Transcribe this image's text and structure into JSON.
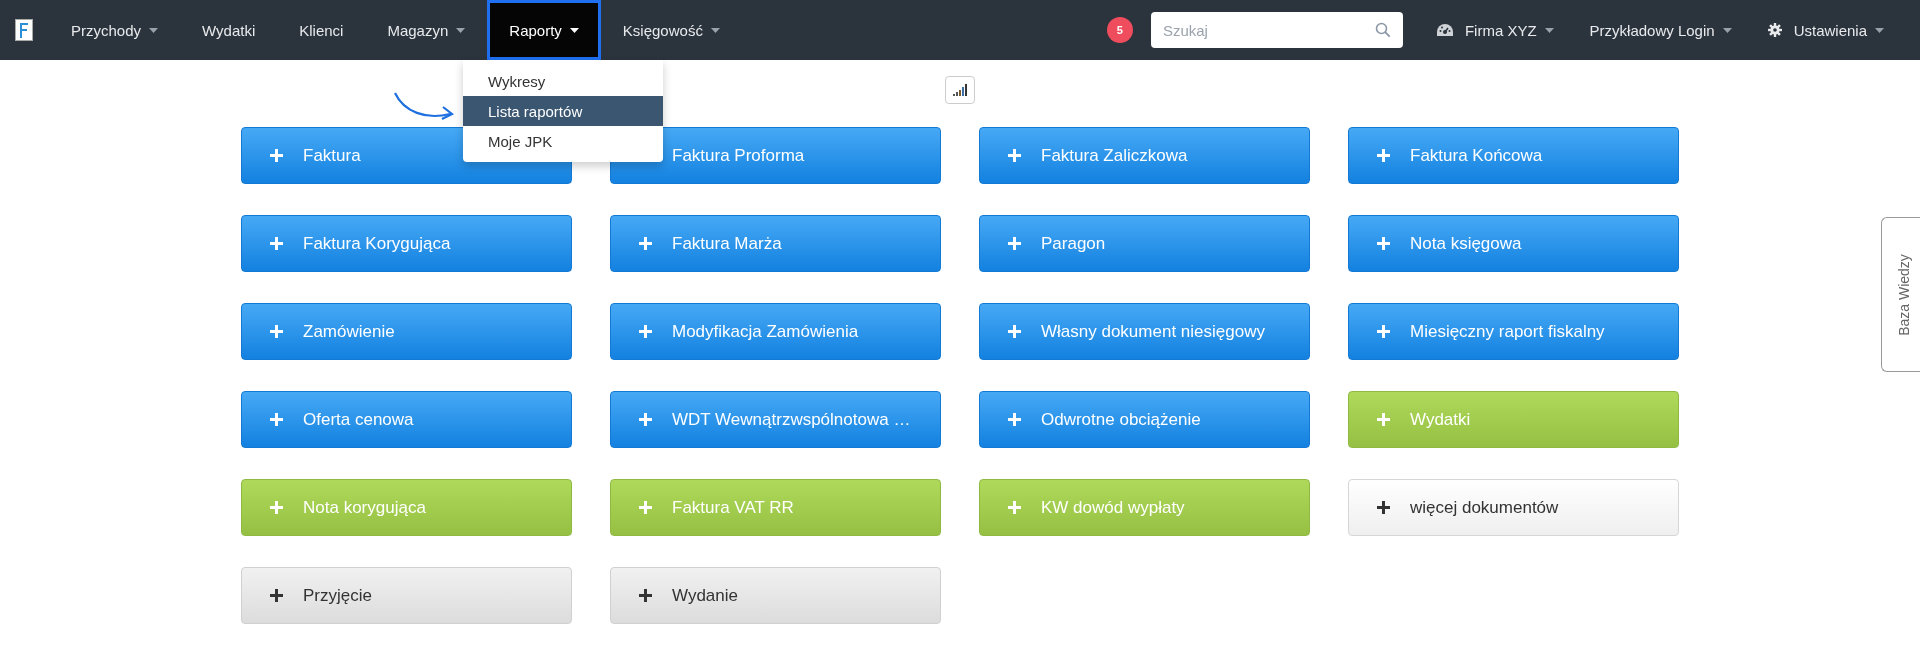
{
  "nav": {
    "items": [
      {
        "label": "Przychody",
        "dropdown": true,
        "selected": false
      },
      {
        "label": "Wydatki",
        "dropdown": false,
        "selected": false
      },
      {
        "label": "Klienci",
        "dropdown": false,
        "selected": false
      },
      {
        "label": "Magazyn",
        "dropdown": true,
        "selected": false
      },
      {
        "label": "Raporty",
        "dropdown": true,
        "selected": true
      },
      {
        "label": "Księgowość",
        "dropdown": true,
        "selected": false
      }
    ],
    "notification_count": "5",
    "search": {
      "placeholder": "Szukaj"
    },
    "right_items": [
      {
        "label": "Firma XYZ"
      },
      {
        "label": "Przykładowy Login"
      },
      {
        "label": "Ustawienia"
      }
    ]
  },
  "dropdown_menu": [
    {
      "label": "Wykresy",
      "selected": false
    },
    {
      "label": "Lista raportów",
      "selected": true
    },
    {
      "label": "Moje JPK",
      "selected": false
    }
  ],
  "buttons": [
    {
      "label": "Faktura",
      "kind": "primary"
    },
    {
      "label": "Faktura Proforma",
      "kind": "primary"
    },
    {
      "label": "Faktura Zaliczkowa",
      "kind": "primary"
    },
    {
      "label": "Faktura Końcowa",
      "kind": "primary"
    },
    {
      "label": "Faktura Korygująca",
      "kind": "primary"
    },
    {
      "label": "Faktura Marża",
      "kind": "primary"
    },
    {
      "label": "Paragon",
      "kind": "primary"
    },
    {
      "label": "Nota księgowa",
      "kind": "primary"
    },
    {
      "label": "Zamówienie",
      "kind": "primary"
    },
    {
      "label": "Modyfikacja Zamówienia",
      "kind": "primary"
    },
    {
      "label": "Własny dokument niesięgowy",
      "kind": "primary"
    },
    {
      "label": "Miesięczny raport fiskalny",
      "kind": "primary"
    },
    {
      "label": "Oferta cenowa",
      "kind": "primary"
    },
    {
      "label": "WDT Wewnątrzwspólnotowa …",
      "kind": "primary"
    },
    {
      "label": "Odwrotne obciążenie",
      "kind": "primary"
    },
    {
      "label": "Wydatki",
      "kind": "success"
    },
    {
      "label": "Nota korygująca",
      "kind": "success"
    },
    {
      "label": "Faktura VAT RR",
      "kind": "success"
    },
    {
      "label": "KW dowód wypłaty",
      "kind": "success"
    },
    {
      "label": "więcej dokumentów",
      "kind": "white"
    },
    {
      "label": "Przyjęcie",
      "kind": "default"
    },
    {
      "label": "Wydanie",
      "kind": "default"
    }
  ],
  "side_tab": {
    "label": "Baza Wiedzy"
  }
}
